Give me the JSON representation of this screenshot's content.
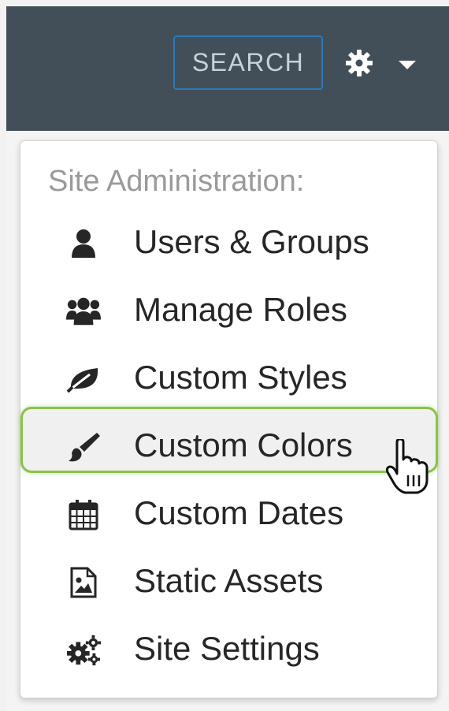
{
  "header": {
    "search_label": "SEARCH",
    "settings_icon": "gear-icon",
    "menu_icon": "caret-down-icon",
    "background": "#434f58"
  },
  "dropdown": {
    "header": "Site Administration:",
    "items": [
      {
        "label": "Users & Groups",
        "icon": "user-icon"
      },
      {
        "label": "Manage Roles",
        "icon": "users-icon"
      },
      {
        "label": "Custom Styles",
        "icon": "leaf-icon"
      },
      {
        "label": "Custom Colors",
        "icon": "paintbrush-icon",
        "highlighted": true
      },
      {
        "label": "Custom Dates",
        "icon": "calendar-icon"
      },
      {
        "label": "Static Assets",
        "icon": "image-file-icon"
      },
      {
        "label": "Site Settings",
        "icon": "cogs-icon"
      }
    ],
    "highlight_color": "#8ac24a"
  }
}
